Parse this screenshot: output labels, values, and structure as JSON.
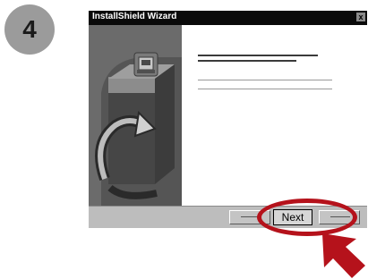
{
  "step": {
    "number": "4",
    "badge_color": "#9b9b9b"
  },
  "window": {
    "title": "InstallShield Wizard",
    "close_label": "x",
    "buttons": {
      "next_label": "Next"
    }
  },
  "annotation": {
    "highlight_color": "#b5121b",
    "arrow_color": "#b5121b",
    "highlight_target": "Next"
  },
  "icons": {
    "installer": "installer-box-icon",
    "close": "close-icon",
    "arrow": "pointer-arrow-icon"
  }
}
